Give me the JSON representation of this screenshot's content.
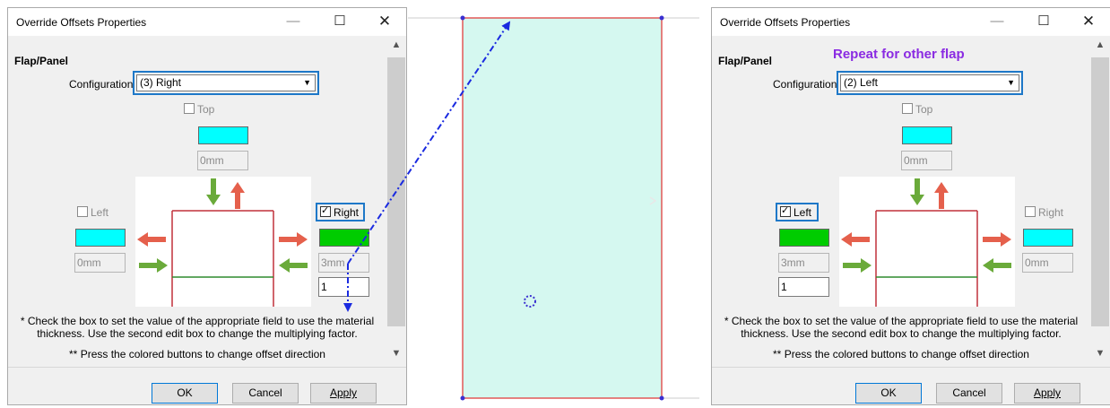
{
  "dialogs": [
    {
      "title": "Override Offsets Properties",
      "window_buttons": {
        "minimize": "—",
        "maximize": "☐",
        "close": "✕"
      },
      "section_label": "Flap/Panel",
      "annotation": "",
      "configuration_label": "Configuration",
      "configuration_value": "(3) Right",
      "top": {
        "label": "Top",
        "checked": false,
        "field_value": "0mm",
        "color": "#00ffff"
      },
      "left": {
        "label": "Left",
        "checked": false,
        "field_value": "0mm",
        "color": "#00ffff"
      },
      "right": {
        "label": "Right",
        "checked": true,
        "field_value": "3mm",
        "factor": "1",
        "color": "#00cc00"
      },
      "note1": "* Check the box to set the value of the appropriate field to use the material",
      "note2": "thickness. Use the second edit box to change the multiplying factor.",
      "note3": "** Press the colored buttons to change offset direction",
      "buttons": {
        "ok": "OK",
        "cancel": "Cancel",
        "apply": "Apply"
      }
    },
    {
      "title": "Override Offsets Properties",
      "window_buttons": {
        "minimize": "—",
        "maximize": "☐",
        "close": "✕"
      },
      "section_label": "Flap/Panel",
      "annotation": "Repeat for other flap",
      "configuration_label": "Configuration",
      "configuration_value": "(2) Left",
      "top": {
        "label": "Top",
        "checked": false,
        "field_value": "0mm",
        "color": "#00ffff"
      },
      "left": {
        "label": "Left",
        "checked": true,
        "field_value": "3mm",
        "factor": "1",
        "color": "#00cc00"
      },
      "right": {
        "label": "Right",
        "checked": false,
        "field_value": "0mm",
        "color": "#00ffff"
      },
      "note1": "* Check the box to set the value of the appropriate field to use the material",
      "note2": "thickness. Use the second edit box to change the multiplying factor.",
      "note3": "** Press the colored buttons to change offset direction",
      "buttons": {
        "ok": "OK",
        "cancel": "Cancel",
        "apply": "Apply"
      }
    }
  ],
  "canvas": {
    "panel_fill": "#d5f8f0",
    "panel_border": "#e03030",
    "vertex_color": "#3a2fd0",
    "arrow_color": "#1a2ae0"
  },
  "colors": {
    "highlight_border": "#1e78c8",
    "annotation_text": "#8a2be2",
    "arrow_red": "#e5604c",
    "arrow_green": "#6aaa3a",
    "diagram_line_green": "#2e8b2e",
    "diagram_line_red": "#c0303a"
  }
}
